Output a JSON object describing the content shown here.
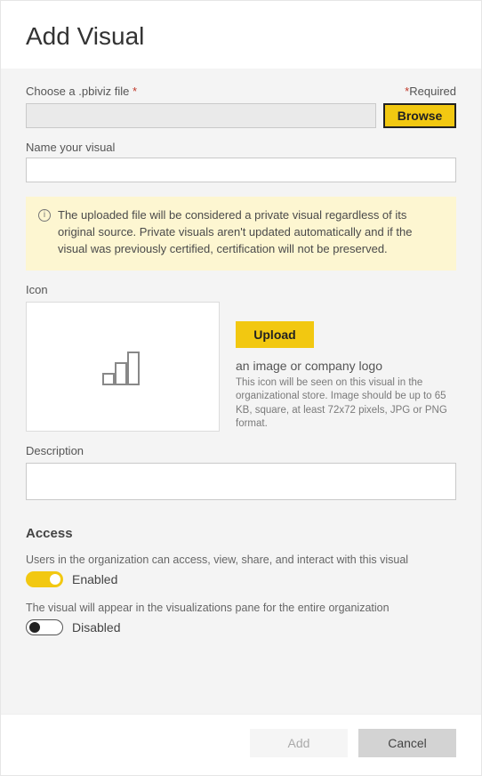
{
  "header": {
    "title": "Add Visual"
  },
  "required_label": "Required",
  "file": {
    "label": "Choose a .pbiviz file",
    "value": "",
    "browse_label": "Browse"
  },
  "name": {
    "label": "Name your visual",
    "value": ""
  },
  "info": {
    "text": "The uploaded file will be considered a private visual regardless of its original source. Private visuals aren't updated automatically and if the visual was previously certified, certification will not be preserved."
  },
  "icon": {
    "label": "Icon",
    "upload_label": "Upload",
    "caption": "an image or company logo",
    "hint": "This icon will be seen on this visual in the organizational store. Image should be up to 65 KB, square, at least 72x72 pixels, JPG or PNG format."
  },
  "description": {
    "label": "Description",
    "value": ""
  },
  "access": {
    "title": "Access",
    "item1": {
      "desc": "Users in the organization can access, view, share, and interact with this visual",
      "state_label": "Enabled",
      "enabled": true
    },
    "item2": {
      "desc": "The visual will appear in the visualizations pane for the entire organization",
      "state_label": "Disabled",
      "enabled": false
    }
  },
  "footer": {
    "add_label": "Add",
    "cancel_label": "Cancel"
  }
}
